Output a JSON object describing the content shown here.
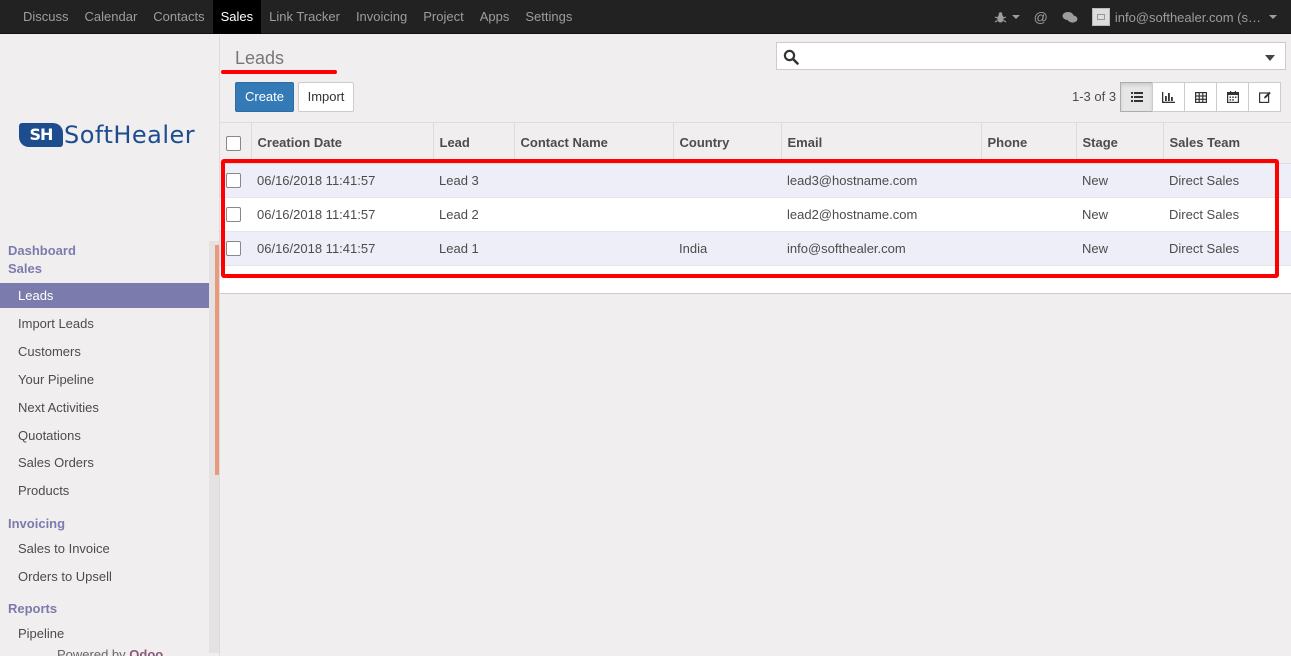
{
  "topbar": {
    "menu": [
      "Discuss",
      "Calendar",
      "Contacts",
      "Sales",
      "Link Tracker",
      "Invoicing",
      "Project",
      "Apps",
      "Settings"
    ],
    "active_index": 3,
    "user_label": "info@softhealer.com (s…",
    "icons": [
      "bug-icon",
      "at-icon",
      "chat-icon"
    ]
  },
  "sidebar": {
    "logo_mark": "SH",
    "logo_text": "SoftHealer",
    "sections": {
      "dashboard": "Dashboard",
      "sales": "Sales",
      "invoicing": "Invoicing",
      "reports": "Reports"
    },
    "sales_items": [
      "Leads",
      "Import Leads",
      "Customers",
      "Your Pipeline",
      "Next Activities",
      "Quotations",
      "Sales Orders",
      "Products"
    ],
    "invoicing_items": [
      "Sales to Invoice",
      "Orders to Upsell"
    ],
    "reports_items": [
      "Pipeline"
    ],
    "powered_prefix": "Powered by",
    "powered_brand": "Odoo"
  },
  "control": {
    "title": "Leads",
    "create_label": "Create",
    "import_label": "Import",
    "search_placeholder": "",
    "pager": "1-3 of 3"
  },
  "table": {
    "columns": [
      "Creation Date",
      "Lead",
      "Contact Name",
      "Country",
      "Email",
      "Phone",
      "Stage",
      "Sales Team"
    ],
    "rows": [
      {
        "date": "06/16/2018 11:41:57",
        "lead": "Lead 3",
        "contact": "",
        "country": "",
        "email": "lead3@hostname.com",
        "phone": "",
        "stage": "New",
        "team": "Direct Sales"
      },
      {
        "date": "06/16/2018 11:41:57",
        "lead": "Lead 2",
        "contact": "",
        "country": "",
        "email": "lead2@hostname.com",
        "phone": "",
        "stage": "New",
        "team": "Direct Sales"
      },
      {
        "date": "06/16/2018 11:41:57",
        "lead": "Lead 1",
        "contact": "",
        "country": "India",
        "email": "info@softhealer.com",
        "phone": "",
        "stage": "New",
        "team": "Direct Sales"
      }
    ]
  },
  "colors": {
    "accent": "#7c7bad",
    "primary_button": "#337ab7",
    "annotation": "#ff0000"
  }
}
